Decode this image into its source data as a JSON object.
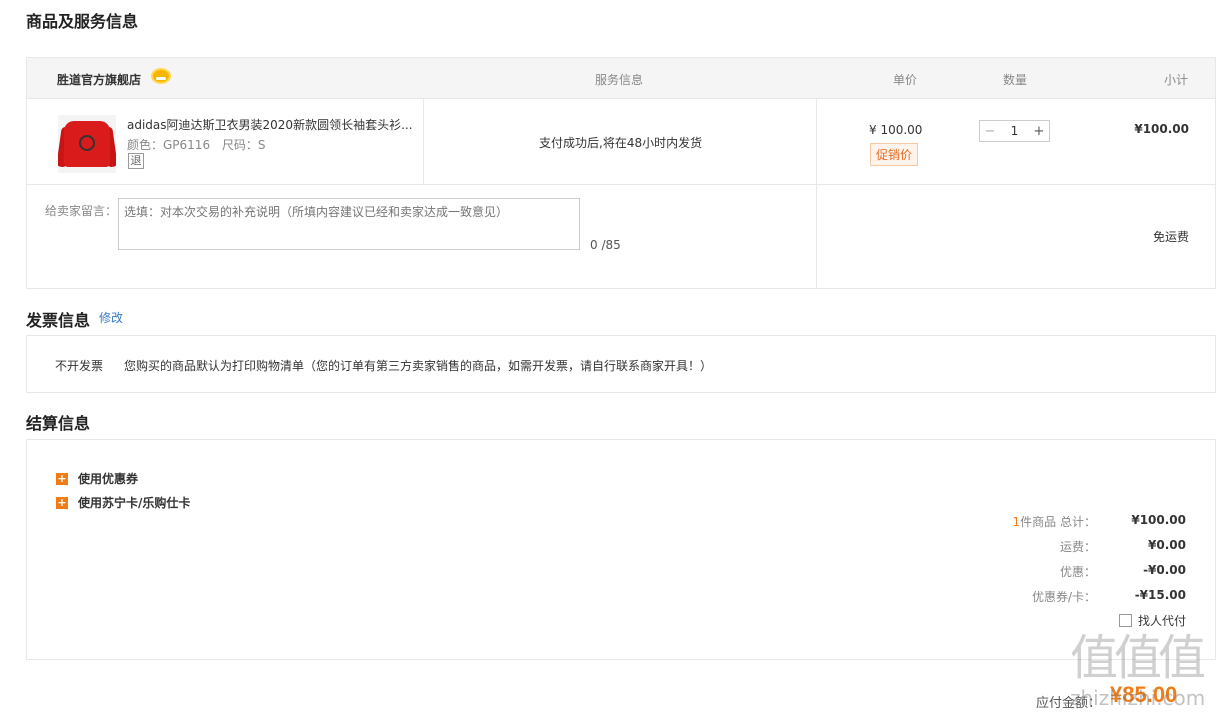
{
  "sections": {
    "goods_info_title": "商品及服务信息",
    "invoice_title": "发票信息",
    "invoice_edit": "修改",
    "settle_title": "结算信息"
  },
  "table_header": {
    "store": "胜道官方旗舰店",
    "service": "服务信息",
    "price": "单价",
    "quantity": "数量",
    "subtotal": "小计"
  },
  "item": {
    "name": "adidas阿迪达斯卫衣男装2020新款圆领长袖套头衫...",
    "color_label": "颜色：GP6116",
    "size_label": "尺码：S",
    "return_badge": "退",
    "service": "支付成功后,将在48小时内发货",
    "price": "¥ 100.00",
    "promo_tag": "促销价",
    "qty_minus": "−",
    "qty": "1",
    "qty_plus": "+",
    "subtotal": "¥100.00"
  },
  "note": {
    "label": "给卖家留言：",
    "placeholder": "选填：对本次交易的补充说明（所填内容建议已经和卖家达成一致意见）",
    "count": "0 /85",
    "shipping": "免运费"
  },
  "invoice": {
    "type": "不开发票",
    "desc": "您购买的商品默认为打印购物清单（您的订单有第三方卖家销售的商品，如需开发票，请自行联系商家开具！）"
  },
  "settle": {
    "coupon": "使用优惠券",
    "card": "使用苏宁卡/乐购仕卡",
    "count_num": "1",
    "count_label": "件商品 总计：",
    "total": "¥100.00",
    "freight_label": "运费：",
    "freight": "¥0.00",
    "discount_label": "优惠：",
    "discount": "-¥0.00",
    "coupon_card_label": "优惠券/卡：",
    "coupon_card": "-¥15.00",
    "agent_pay": "找人代付"
  },
  "payable": {
    "label": "应付金额：",
    "value": "¥85.00"
  },
  "watermark": {
    "chars": "值值值",
    "url": "zhizhizhi.com"
  }
}
